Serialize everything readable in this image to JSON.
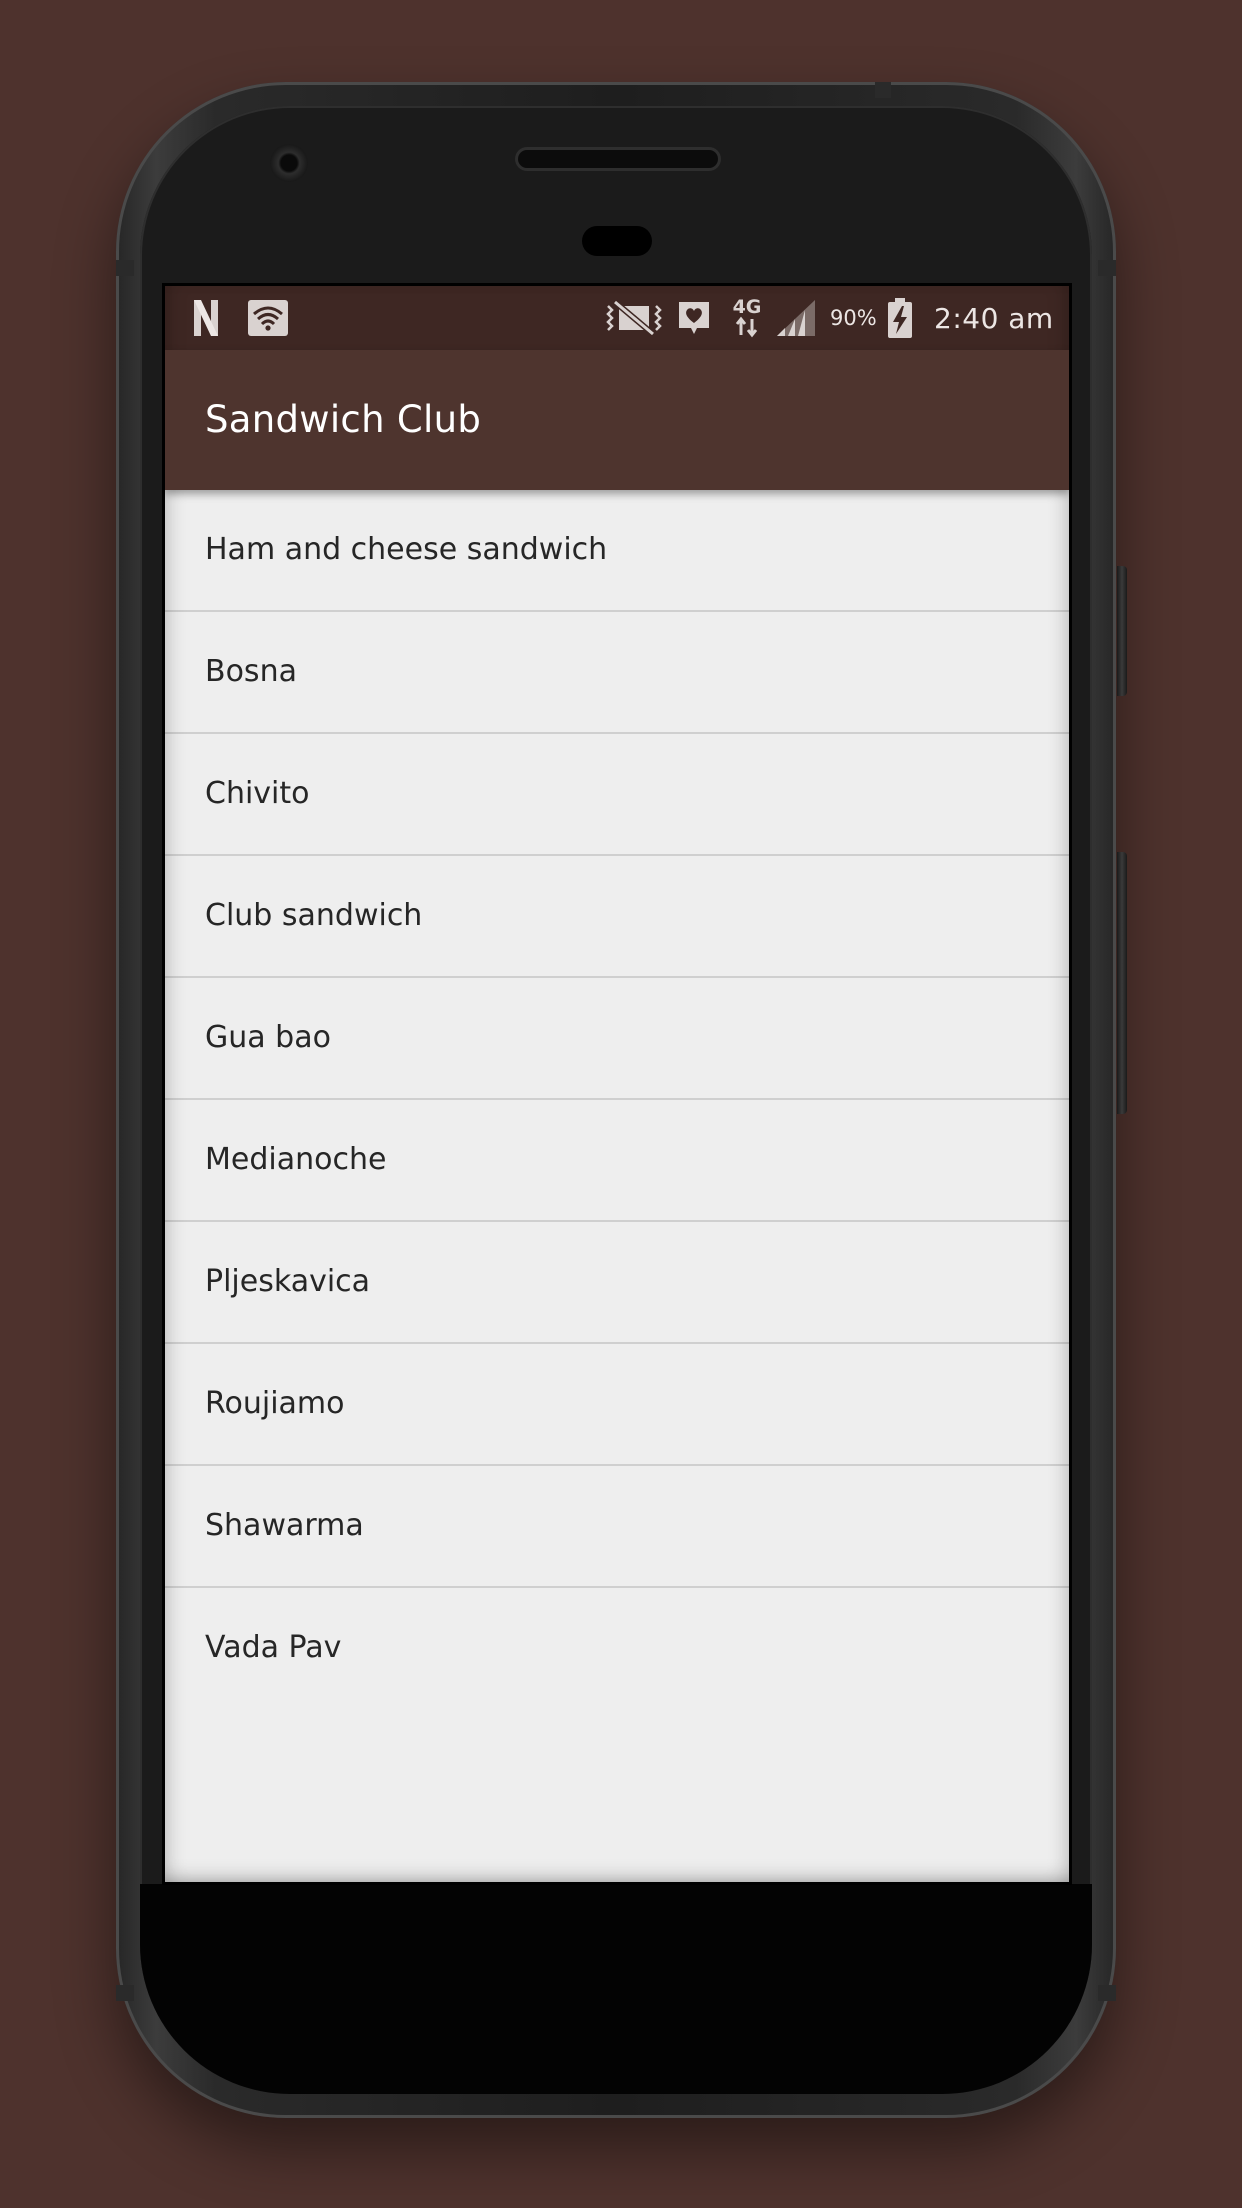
{
  "status_bar": {
    "battery": "90%",
    "time": "2:40 am",
    "network": "4G",
    "icons": [
      "netflix-n-icon",
      "wifi-icon",
      "vibrate-mute-icon",
      "health-icon",
      "network-4g-icon",
      "signal-icon",
      "battery-charging-icon"
    ]
  },
  "app_bar": {
    "title": "Sandwich Club"
  },
  "sandwiches": [
    "Ham and cheese sandwich",
    "Bosna",
    "Chivito",
    "Club sandwich",
    "Gua bao",
    "Medianoche",
    "Pljeskavica",
    "Roujiamo",
    "Shawarma",
    "Vada Pav"
  ],
  "colors": {
    "background": "#4e322d",
    "status_bar": "#3e2723",
    "app_bar": "#4e342e",
    "list_background": "#eeeeee",
    "divider": "#cfcfcf",
    "list_text": "#262626"
  }
}
